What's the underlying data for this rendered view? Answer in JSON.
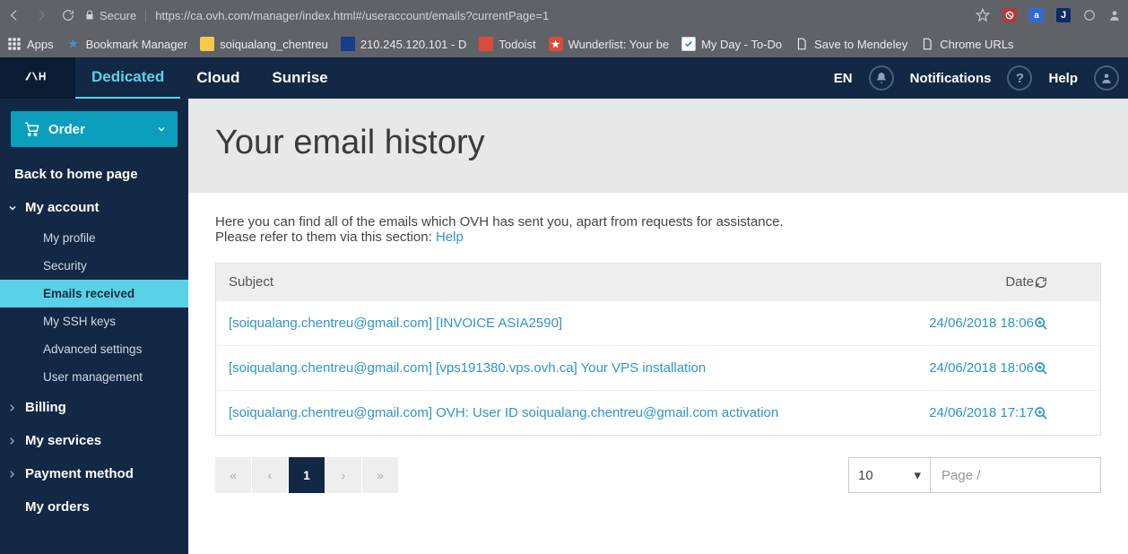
{
  "browser": {
    "secure_label": "Secure",
    "url": "https://ca.ovh.com/manager/index.html#/useraccount/emails?currentPage=1",
    "apps_label": "Apps",
    "bookmarks": [
      {
        "label": "Bookmark Manager"
      },
      {
        "label": "soiqualang_chentreu"
      },
      {
        "label": "210.245.120.101 - D"
      },
      {
        "label": "Todoist"
      },
      {
        "label": "Wunderlist: Your be"
      },
      {
        "label": "My Day - To-Do"
      },
      {
        "label": "Save to Mendeley"
      },
      {
        "label": "Chrome URLs"
      }
    ]
  },
  "topnav": {
    "tabs": [
      {
        "label": "Dedicated",
        "active": true
      },
      {
        "label": "Cloud"
      },
      {
        "label": "Sunrise"
      }
    ],
    "lang": "EN",
    "notifications": "Notifications",
    "help": "Help"
  },
  "sidebar": {
    "order": "Order",
    "back": "Back to home page",
    "account_section": "My account",
    "account_items": [
      {
        "label": "My profile"
      },
      {
        "label": "Security"
      },
      {
        "label": "Emails received",
        "active": true
      },
      {
        "label": "My SSH keys"
      },
      {
        "label": "Advanced settings"
      },
      {
        "label": "User management"
      }
    ],
    "other_sections": [
      {
        "label": "Billing"
      },
      {
        "label": "My services"
      },
      {
        "label": "Payment method"
      },
      {
        "label": "My orders"
      }
    ]
  },
  "page": {
    "title": "Your email history",
    "intro1": "Here you can find all of the emails which OVH has sent you, apart from requests for assistance.",
    "intro2_pre": "Please refer to them via this section: ",
    "intro2_link": "Help",
    "table": {
      "col_subject": "Subject",
      "col_date": "Date",
      "rows": [
        {
          "subject": "[soiqualang.chentreu@gmail.com] [INVOICE ASIA2590]",
          "date": "24/06/2018 18:06"
        },
        {
          "subject": "[soiqualang.chentreu@gmail.com] [vps191380.vps.ovh.ca] Your VPS installation",
          "date": "24/06/2018 18:06"
        },
        {
          "subject": "[soiqualang.chentreu@gmail.com] OVH: User ID soiqualang.chentreu@gmail.com activation",
          "date": "24/06/2018 17:17"
        }
      ]
    },
    "pagination": {
      "current": "1",
      "page_size": "10",
      "page_input_placeholder": "Page /"
    }
  }
}
